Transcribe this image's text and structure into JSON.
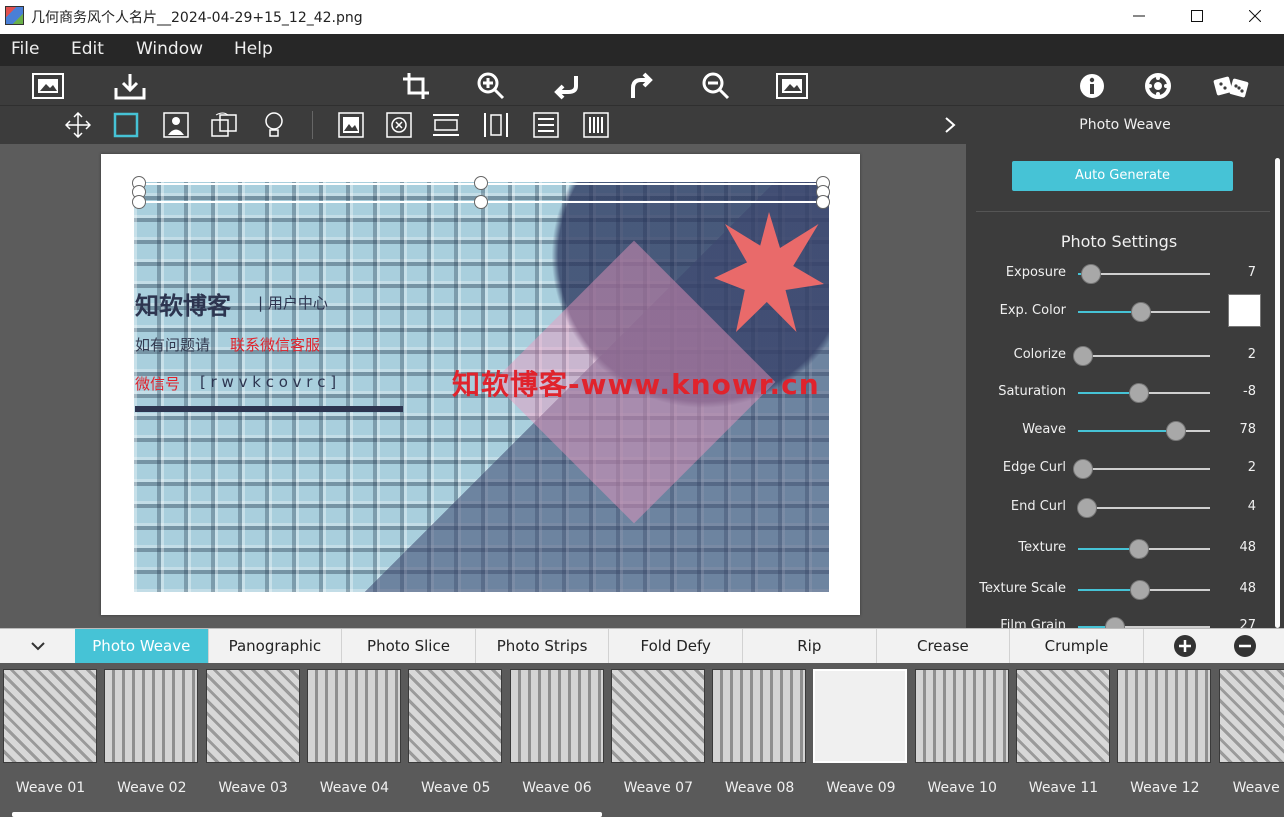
{
  "window": {
    "title": "几何商务风个人名片__2024-04-29+15_12_42.png"
  },
  "menu": [
    "File",
    "Edit",
    "Window",
    "Help"
  ],
  "toolbar_top": {
    "icons": [
      "open-image-icon",
      "save-icon",
      "crop-icon",
      "zoom-in-icon",
      "undo-icon",
      "redo-icon",
      "zoom-out-icon",
      "fit-image-icon",
      "info-icon",
      "settings-icon",
      "random-dice-icon"
    ]
  },
  "toolbar_tools": {
    "icons": [
      "move-icon",
      "select-rect-icon",
      "portrait-icon",
      "rotate-icon",
      "bulb-icon",
      "image-icon",
      "remove-icon",
      "split-horizontal-icon",
      "split-vertical-icon",
      "rows-icon",
      "columns-icon"
    ]
  },
  "panel": {
    "header": "Photo Weave",
    "auto_generate": "Auto Generate",
    "settings_title": "Photo Settings",
    "sliders": [
      {
        "label": "Exposure",
        "value": "7",
        "fraction": 0.1
      },
      {
        "label": "Exp. Color",
        "value": "",
        "fraction": 0.48
      },
      {
        "label": "Colorize",
        "value": "2",
        "fraction": 0.04
      },
      {
        "label": "Saturation",
        "value": "-8",
        "fraction": 0.46
      },
      {
        "label": "Weave",
        "value": "78",
        "fraction": 0.74
      },
      {
        "label": "Edge Curl",
        "value": "2",
        "fraction": 0.04
      },
      {
        "label": "End Curl",
        "value": "4",
        "fraction": 0.07
      },
      {
        "label": "Texture",
        "value": "48",
        "fraction": 0.46
      },
      {
        "label": "Texture Scale",
        "value": "48",
        "fraction": 0.47
      },
      {
        "label": "Film Grain",
        "value": "27",
        "fraction": 0.28
      }
    ],
    "exp_color": "#ffffff"
  },
  "card": {
    "line1": "知软博客",
    "line1b": "| 用户中心",
    "line2a": "如有问题请",
    "line2b": "联系微信客服",
    "line3a": "微信号",
    "line3b": "[ r w v k c o v r c  ]",
    "watermark": "知软博客-www.knowr.cn"
  },
  "tabs": [
    "Photo Weave",
    "Panographic",
    "Photo Slice",
    "Photo Strips",
    "Fold Defy",
    "Rip",
    "Crease",
    "Crumple"
  ],
  "active_tab": 0,
  "thumbnails": [
    "Weave 01",
    "Weave 02",
    "Weave 03",
    "Weave 04",
    "Weave 05",
    "Weave 06",
    "Weave 07",
    "Weave 08",
    "Weave 09",
    "Weave 10",
    "Weave 11",
    "Weave 12",
    "Weave"
  ],
  "selected_thumb": 8,
  "colors": {
    "accent": "#46c3d6",
    "watermark": "#e0232c"
  }
}
